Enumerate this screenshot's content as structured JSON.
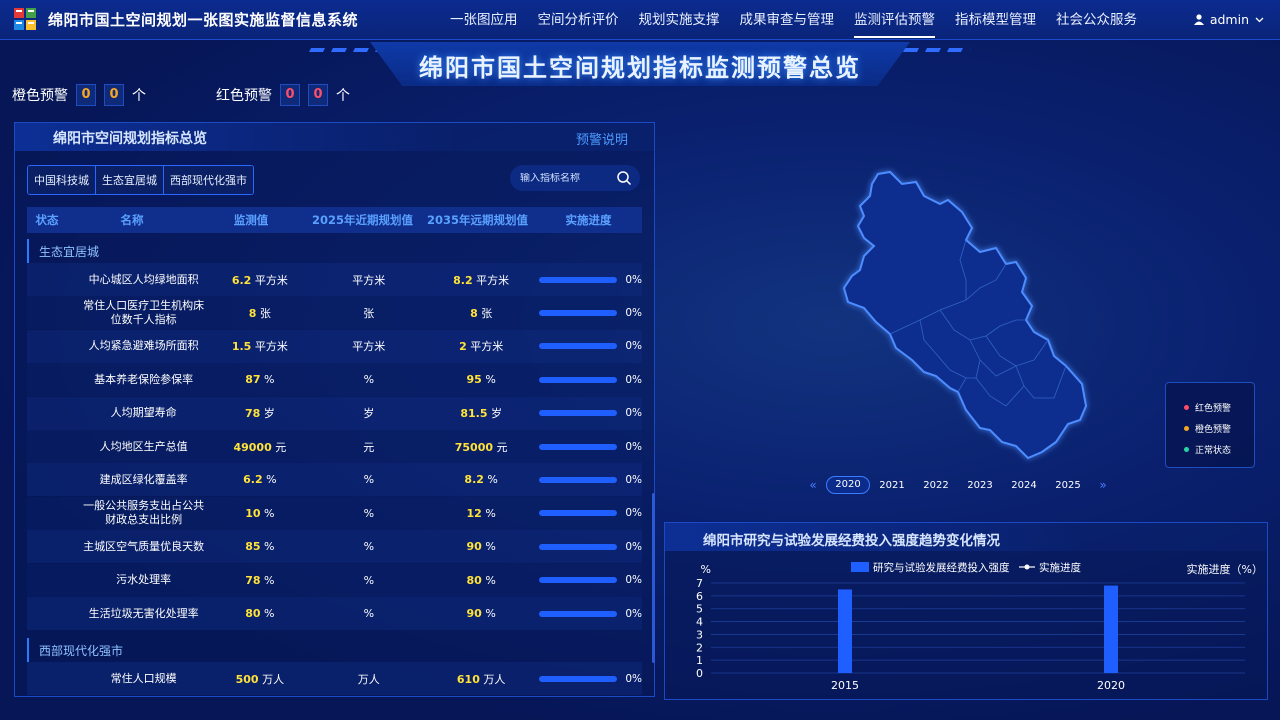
{
  "header": {
    "app_title": "绵阳市国土空间规划一张图实施监督信息系统",
    "nav": [
      {
        "label": "一张图应用"
      },
      {
        "label": "空间分析评价"
      },
      {
        "label": "规划实施支撑"
      },
      {
        "label": "成果审查与管理"
      },
      {
        "label": "监测评估预警",
        "active": true
      },
      {
        "label": "指标模型管理"
      },
      {
        "label": "社会公众服务"
      }
    ],
    "user": "admin"
  },
  "banner": {
    "title": "绵阳市国土空间规划指标监测预警总览"
  },
  "warnings": {
    "orange_label": "橙色预警",
    "orange_digits": [
      "0",
      "0"
    ],
    "red_label": "红色预警",
    "red_digits": [
      "0",
      "0"
    ],
    "unit": "个"
  },
  "panel": {
    "title": "绵阳市空间规划指标总览",
    "link": "预警说明",
    "tabs": [
      "中国科技城",
      "生态宜居城",
      "西部现代化强市"
    ],
    "search_placeholder": "输入指标名称",
    "columns": [
      "状态",
      "名称",
      "监测值",
      "2025年近期规划值",
      "2035年远期规划值",
      "实施进度"
    ],
    "groups": [
      "生态宜居城",
      "西部现代化强市"
    ],
    "rows": [
      {
        "name": "中心城区人均绿地面积",
        "mon": "6.2",
        "mon_unit": "平方米",
        "v2025": "平方米",
        "v2035": "8.2",
        "v2035_unit": "平方米",
        "progress": "0%"
      },
      {
        "name": "常住人口医疗卫生机构床位数千人指标",
        "mon": "8",
        "mon_unit": "张",
        "v2025": "张",
        "v2035": "8",
        "v2035_unit": "张",
        "progress": "0%"
      },
      {
        "name": "人均紧急避难场所面积",
        "mon": "1.5",
        "mon_unit": "平方米",
        "v2025": "平方米",
        "v2035": "2",
        "v2035_unit": "平方米",
        "progress": "0%"
      },
      {
        "name": "基本养老保险参保率",
        "mon": "87",
        "mon_unit": "%",
        "v2025": "%",
        "v2035": "95",
        "v2035_unit": "%",
        "progress": "0%"
      },
      {
        "name": "人均期望寿命",
        "mon": "78",
        "mon_unit": "岁",
        "v2025": "岁",
        "v2035": "81.5",
        "v2035_unit": "岁",
        "progress": "0%"
      },
      {
        "name": "人均地区生产总值",
        "mon": "49000",
        "mon_unit": "元",
        "v2025": "元",
        "v2035": "75000",
        "v2035_unit": "元",
        "progress": "0%"
      },
      {
        "name": "建成区绿化覆盖率",
        "mon": "6.2",
        "mon_unit": "%",
        "v2025": "%",
        "v2035": "8.2",
        "v2035_unit": "%",
        "progress": "0%"
      },
      {
        "name": "一般公共服务支出占公共财政总支出比例",
        "mon": "10",
        "mon_unit": "%",
        "v2025": "%",
        "v2035": "12",
        "v2035_unit": "%",
        "progress": "0%"
      },
      {
        "name": "主城区空气质量优良天数",
        "mon": "85",
        "mon_unit": "%",
        "v2025": "%",
        "v2035": "90",
        "v2035_unit": "%",
        "progress": "0%"
      },
      {
        "name": "污水处理率",
        "mon": "78",
        "mon_unit": "%",
        "v2025": "%",
        "v2035": "80",
        "v2035_unit": "%",
        "progress": "0%"
      },
      {
        "name": "生活垃圾无害化处理率",
        "mon": "80",
        "mon_unit": "%",
        "v2025": "%",
        "v2035": "90",
        "v2035_unit": "%",
        "progress": "0%"
      },
      {
        "name": "常住人口规模",
        "mon": "500",
        "mon_unit": "万人",
        "v2025": "万人",
        "v2035": "610",
        "v2035_unit": "万人",
        "progress": "0%"
      }
    ]
  },
  "legend": [
    "红色预警",
    "橙色预警",
    "正常状态"
  ],
  "legend_colors": [
    "#ff4d6a",
    "#f5a623",
    "#25d6a2"
  ],
  "years": [
    "2020",
    "2021",
    "2022",
    "2023",
    "2024",
    "2025"
  ],
  "chart_panel": {
    "title": "绵阳市研究与试验发展经费投入强度趋势变化情况"
  },
  "chart_data": {
    "type": "bar",
    "categories": [
      "2015",
      "2020"
    ],
    "series": [
      {
        "name": "研究与试验发展经费投入强度",
        "values": [
          6.5,
          6.8
        ]
      },
      {
        "name": "实施进度",
        "values": []
      }
    ],
    "ylabel_left": "%",
    "ylabel_right": "实施进度（%）",
    "yticks": [
      "0",
      "1",
      "2",
      "3",
      "4",
      "5",
      "6",
      "7"
    ],
    "ylim": [
      0,
      7
    ]
  }
}
